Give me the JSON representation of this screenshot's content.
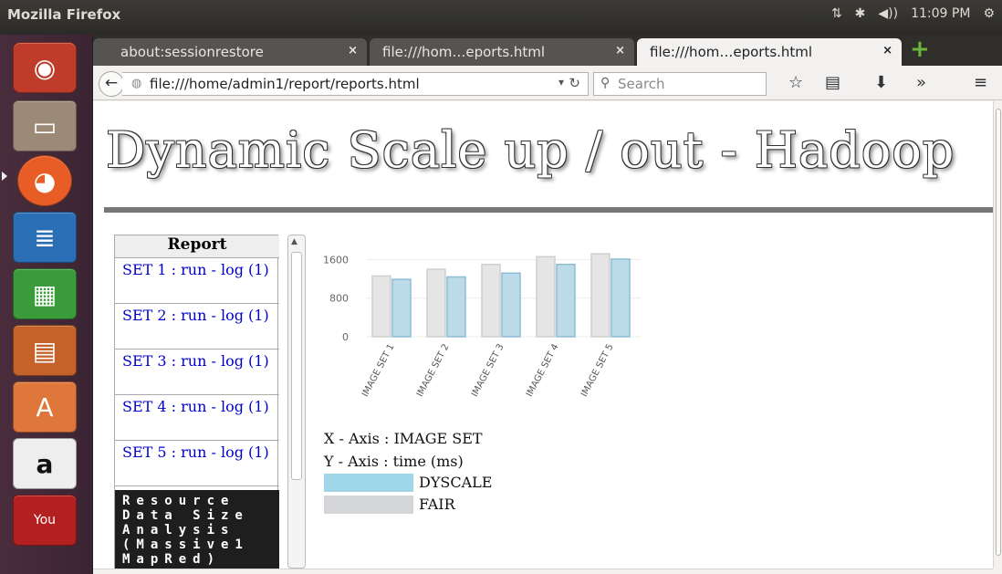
{
  "system": {
    "app_title": "Mozilla Firefox",
    "clock": "11:09 PM",
    "indicator_icons": [
      "network-icon",
      "bluetooth-icon",
      "volume-icon",
      "settings-gear-icon"
    ]
  },
  "launcher": {
    "items": [
      "ubuntu-dash-icon",
      "files-icon",
      "firefox-icon",
      "libreoffice-writer-icon",
      "libreoffice-calc-icon",
      "libreoffice-impress-icon",
      "software-center-icon",
      "amazon-icon",
      "youtube-icon"
    ]
  },
  "browser": {
    "tabs": [
      {
        "label": "about:sessionrestore",
        "close": "×"
      },
      {
        "label": "file:///hom…eports.html",
        "close": "×"
      },
      {
        "label": "file:///hom…eports.html",
        "close": "×"
      }
    ],
    "url": "file:///home/admin1/report/reports.html",
    "search_placeholder": "Search"
  },
  "page": {
    "title": "Dynamic Scale up / out - Hadoop",
    "report": {
      "heading": "Report",
      "items": [
        {
          "label": "SET 1 : run - log (1)"
        },
        {
          "label": "SET 2 : run - log (1)"
        },
        {
          "label": "SET 3 : run - log (1)"
        },
        {
          "label": "SET 4 : run - log (1)"
        },
        {
          "label": "SET 5 : run - log (1)"
        }
      ],
      "terminal_text": "Resource\nData Size\nAnalysis\n(Massive1\nMapRed)"
    },
    "legend": {
      "x_axis": "X - Axis : IMAGE SET",
      "y_axis": "Y - Axis : time (ms)",
      "series": [
        {
          "label": "DYSCALE",
          "color": "#9fd6ea"
        },
        {
          "label": "FAIR",
          "color": "#d4d6d8"
        }
      ]
    }
  },
  "chart_data": {
    "type": "bar",
    "categories": [
      "IMAGE SET 1",
      "IMAGE SET 2",
      "IMAGE SET 3",
      "IMAGE SET 4",
      "IMAGE SET 5"
    ],
    "series": [
      {
        "name": "FAIR",
        "values": [
          1260,
          1400,
          1500,
          1660,
          1720
        ],
        "color": "#e5e5e5",
        "stroke": "#cfcfcf"
      },
      {
        "name": "DYSCALE",
        "values": [
          1190,
          1240,
          1320,
          1500,
          1610
        ],
        "color": "#bcdbe8",
        "stroke": "#8fbcd3"
      }
    ],
    "yticks": [
      "1600",
      "800",
      "0"
    ],
    "ylim": [
      0,
      1760
    ],
    "title": "",
    "xlabel": "",
    "ylabel": ""
  }
}
